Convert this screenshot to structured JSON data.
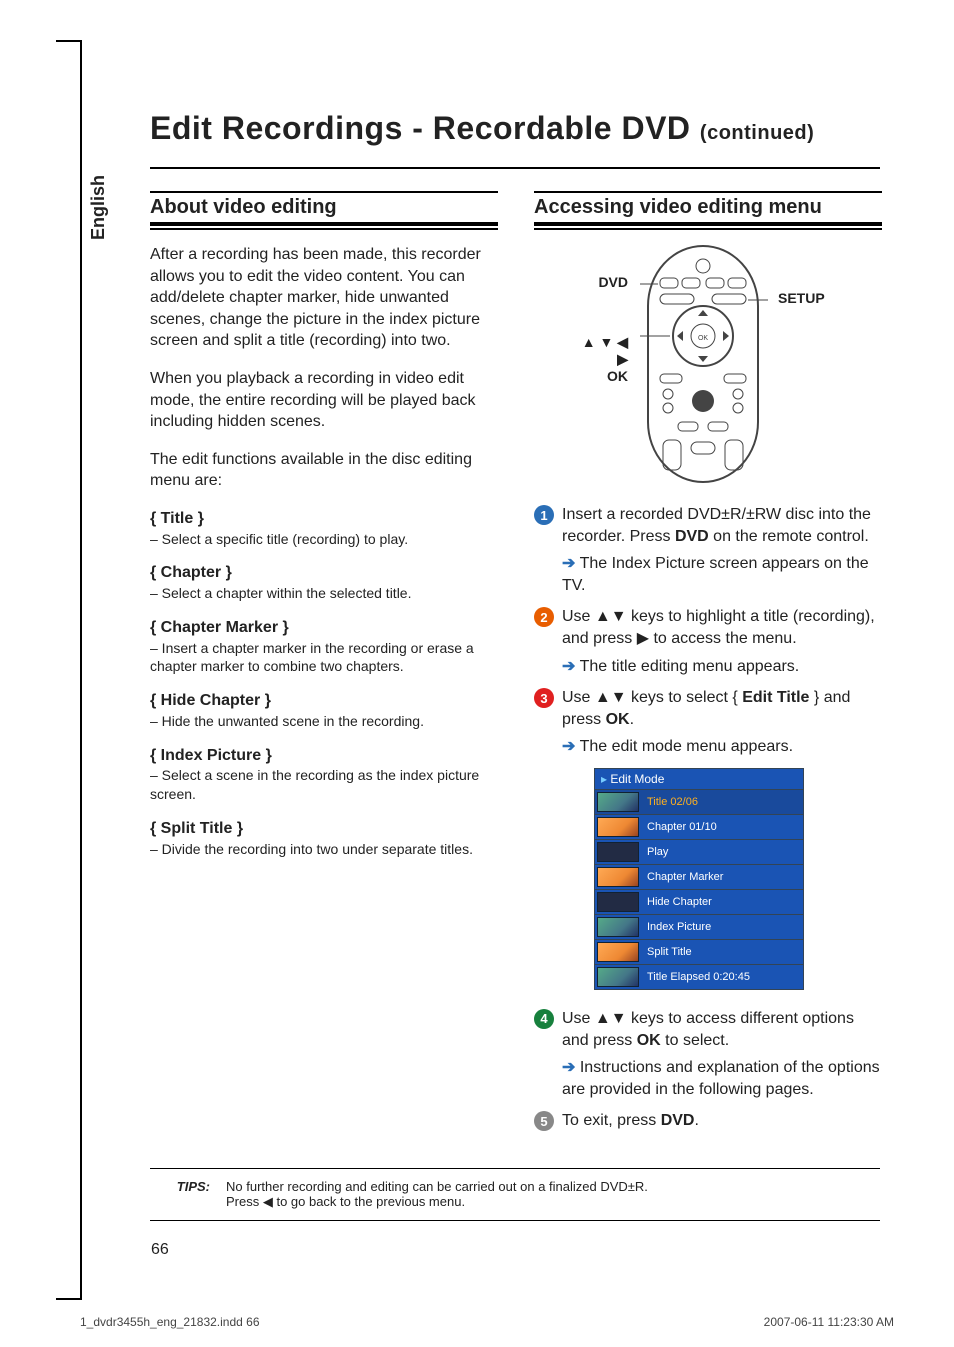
{
  "lang_tab": "English",
  "page_title_main": "Edit Recordings - Recordable DVD ",
  "page_title_cont": "(continued)",
  "left": {
    "section_heading": "About video editing",
    "para1": "After a recording has been made, this recorder allows you to edit the video content. You can add/delete chapter marker, hide unwanted scenes, change the picture in the index picture screen and split a title (recording) into two.",
    "para2": "When you playback a recording in video edit mode, the entire recording will be played back including hidden scenes.",
    "para3": "The edit functions available in the disc editing menu are:",
    "opts": [
      {
        "t": "{ Title }",
        "d": "–  Select a specific title (recording) to play."
      },
      {
        "t": "{ Chapter }",
        "d": "–  Select a chapter within the selected title."
      },
      {
        "t": "{ Chapter Marker }",
        "d": "–  Insert a chapter marker in the recording or erase a chapter marker to combine two chapters."
      },
      {
        "t": "{ Hide Chapter }",
        "d": "–  Hide the unwanted scene in the recording."
      },
      {
        "t": "{ Index Picture }",
        "d": "–  Select a scene in the recording as the index picture screen."
      },
      {
        "t": "{ Split Title }",
        "d": "–  Divide the recording into two under separate titles."
      }
    ]
  },
  "right": {
    "section_heading": "Accessing video editing menu",
    "fig_labels": {
      "dvd": "DVD",
      "nav": "▲ ▼ ◀ ▶\nOK",
      "setup": "SETUP"
    },
    "step1": "Insert a recorded DVD±R/±RW disc into the recorder. Press DVD on the remote control.",
    "step1_res": "The Index Picture screen appears on the TV.",
    "step2": "Use ▲▼ keys to highlight a title (recording), and press ▶ to access the menu.",
    "step2_res": "The title editing menu appears.",
    "step3": "Use ▲▼ keys to select { Edit Title } and press OK.",
    "step3_res": "The edit mode menu appears.",
    "osd": {
      "head": "Edit Mode",
      "rows": [
        {
          "label": "Title 02/06",
          "sel": true
        },
        {
          "label": "Chapter 01/10",
          "cls": "orange"
        },
        {
          "label": "Play",
          "cls": "dark"
        },
        {
          "label": "Chapter Marker",
          "cls": "orange"
        },
        {
          "label": "Hide Chapter",
          "cls": "dark"
        },
        {
          "label": "Index Picture"
        },
        {
          "label": "Split Title",
          "cls": "orange"
        },
        {
          "label": "Title Elapsed 0:20:45"
        }
      ]
    },
    "step4": "Use ▲▼ keys to access different options and press OK to select.",
    "step4_res": "Instructions and explanation of the options are provided in the following pages.",
    "step5": "To exit, press DVD."
  },
  "tips": {
    "label": "TIPS:",
    "line1": "No further recording and editing can be carried out on a finalized DVD±R.",
    "line2": "Press ◀ to go back to the previous menu."
  },
  "page_num": "66",
  "footer_left": "1_dvdr3455h_eng_21832.indd   66",
  "footer_right": "2007-06-11   11:23:30 AM"
}
